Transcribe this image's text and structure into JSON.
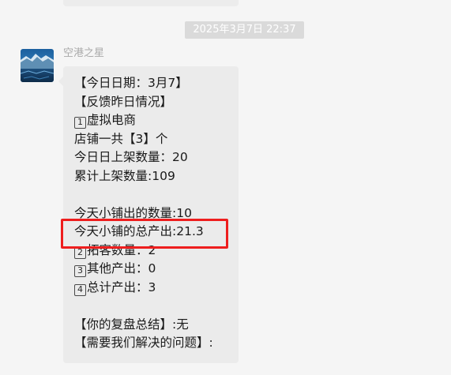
{
  "timestamp": "2025年3月7日 22:37",
  "sender": {
    "name": "空港之星",
    "avatar_icon": "mountain-lake-avatar"
  },
  "message": {
    "lines": [
      "【今日日期：3月7】",
      "【反馈昨日情况】",
      "虚拟电商",
      "店铺一共【3】个",
      "今日日上架数量：20",
      "累计上架数量:109",
      "",
      "今天小铺出的数量:10",
      "今天小铺的总产出:21.3",
      "拓客数量：2",
      "其他产出：0",
      "总计产出：3",
      "",
      "【你的复盘总结】:无",
      "【需要我们解决的问题】:"
    ],
    "keycaps": {
      "line_2": "1",
      "line_9": "2",
      "line_10": "3",
      "line_11": "4"
    }
  },
  "highlight": {
    "color": "#ee1e1e",
    "target": "今天小铺的总产出:21.3"
  }
}
